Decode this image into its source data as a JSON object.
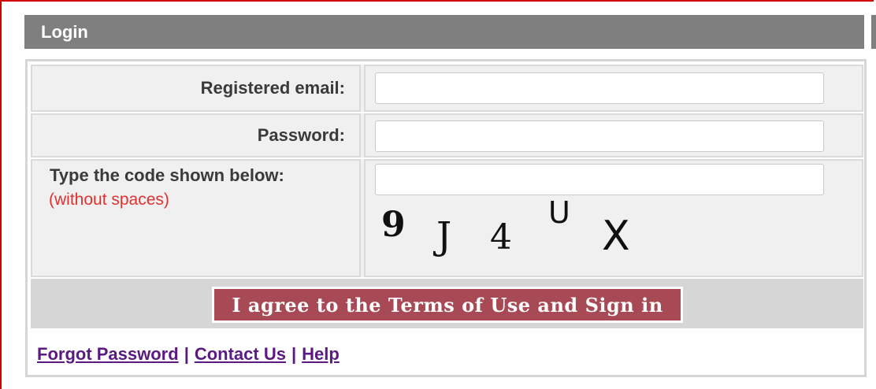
{
  "header": {
    "title": "Login"
  },
  "form": {
    "email": {
      "label": "Registered email:",
      "value": "",
      "placeholder": ""
    },
    "password": {
      "label": "Password:",
      "value": "",
      "placeholder": ""
    },
    "captcha": {
      "label": "Type the code shown below:",
      "note": "(without spaces)",
      "value": "",
      "placeholder": "",
      "chars": [
        "9",
        "J",
        "4",
        "U",
        "X"
      ]
    },
    "submit_label": "I agree to the Terms of Use and Sign in"
  },
  "links": {
    "forgot": "Forgot Password",
    "separator": "|",
    "contact": "Contact Us",
    "help": "Help"
  },
  "colors": {
    "header_bg": "#7f7f7f",
    "button_bg": "#a84a55",
    "note_red": "#e03030",
    "link": "#5a1a82",
    "highlight": "#f4f43a"
  }
}
